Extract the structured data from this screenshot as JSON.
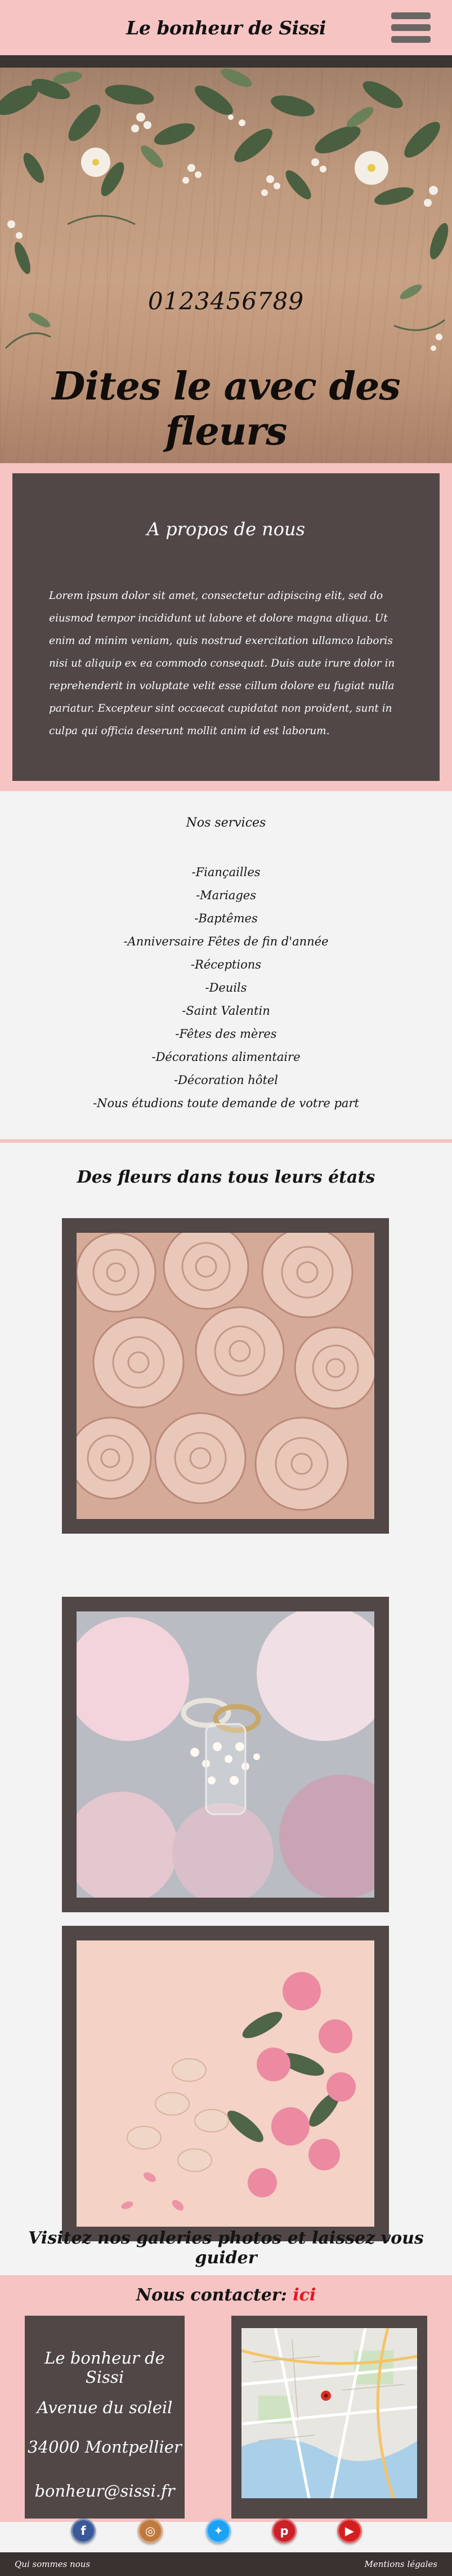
{
  "header": {
    "site_title": "Le bonheur de Sissi",
    "menu_icon": "hamburger-menu-icon"
  },
  "hero": {
    "phone": "0123456789",
    "tagline": "Dites le avec des fleurs"
  },
  "about": {
    "title": "A propos de nous",
    "text": "Lorem ipsum dolor sit amet, consectetur adipiscing elit, sed do eiusmod tempor incididunt ut labore et dolore magna aliqua. Ut enim ad minim veniam, quis nostrud exercitation ullamco laboris nisi ut aliquip ex ea commodo consequat. Duis aute irure dolor in reprehenderit in voluptate velit esse cillum dolore eu fugiat nulla pariatur. Excepteur sint occaecat cupidatat non proident, sunt in culpa qui officia deserunt mollit anim id est laborum."
  },
  "services": {
    "title": "Nos services",
    "items": [
      "-Fiançailles",
      "-Mariages",
      "-Baptêmes",
      "-Anniversaire Fêtes de fin d'année",
      "-Réceptions",
      "-Deuils",
      "-Saint Valentin",
      "-Fêtes des mères",
      "-Décorations alimentaire",
      "-Décoration hôtel",
      "-Nous étudions toute demande de votre part"
    ]
  },
  "gallery": {
    "title": "Des fleurs dans tous leurs états",
    "cta": "Visitez nos galeries photos et laissez vous guider"
  },
  "contact": {
    "title": "Nous contacter: ",
    "link_label": "ici",
    "name": "Le bonheur de Sissi",
    "street": "Avenue du soleil",
    "city": "34000   Montpellier",
    "email": "bonheur@sissi.fr"
  },
  "social": [
    {
      "icon": "facebook-icon",
      "glyph": "f",
      "color": "#3b5998"
    },
    {
      "icon": "instagram-icon",
      "glyph": "◎",
      "color": "#c07a3e"
    },
    {
      "icon": "twitter-icon",
      "glyph": "✦",
      "color": "#1da1f2"
    },
    {
      "icon": "pinterest-icon",
      "glyph": "p",
      "color": "#cb2027"
    },
    {
      "icon": "youtube-icon",
      "glyph": "▶",
      "color": "#d51f1f"
    }
  ],
  "footer": {
    "left": "Qui sommes nous",
    "right": "Mentions légales"
  }
}
